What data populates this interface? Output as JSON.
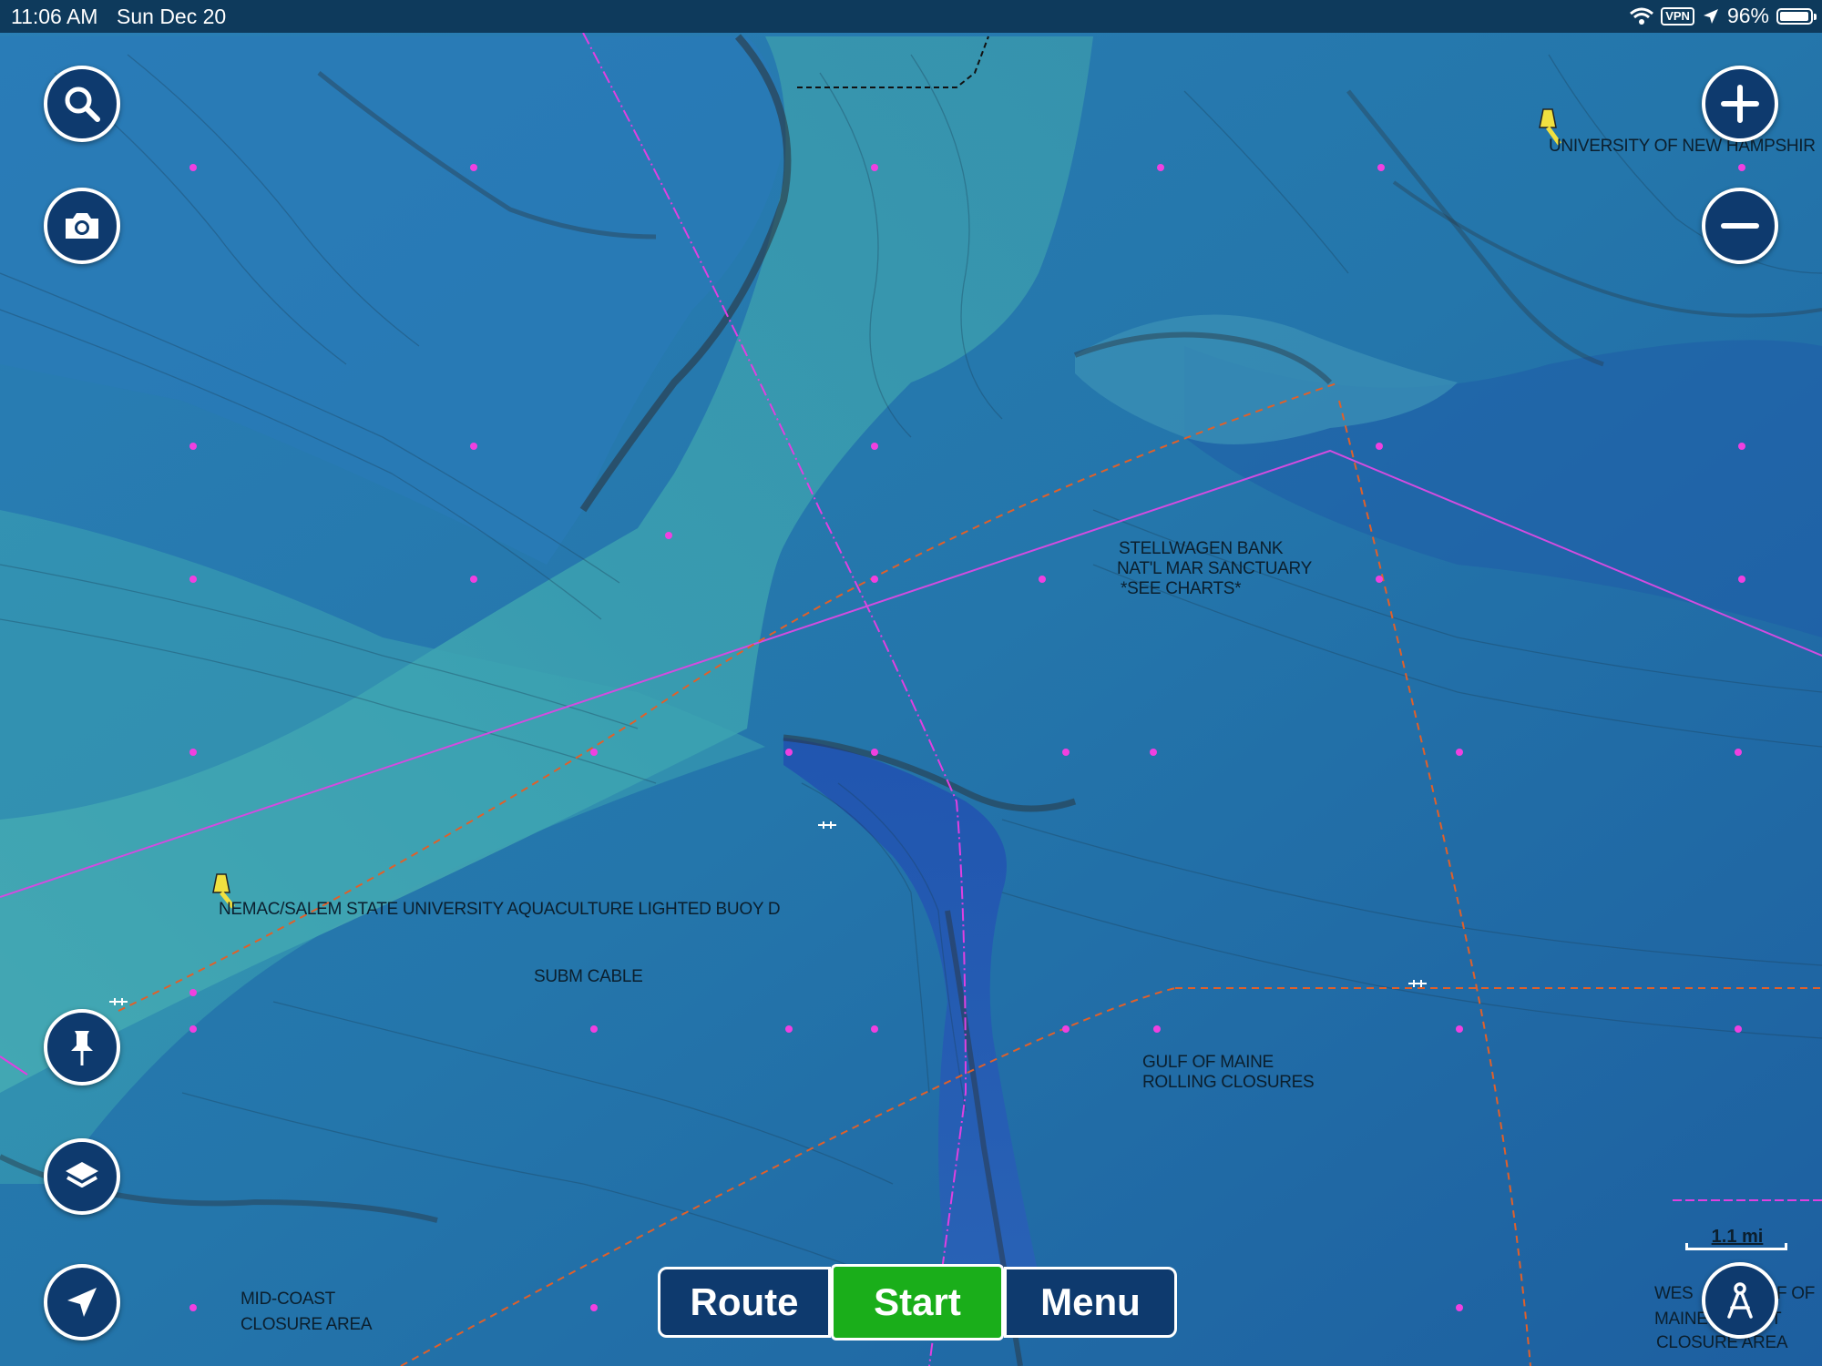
{
  "status_bar": {
    "time": "11:06 AM",
    "date": "Sun Dec 20",
    "vpn_label": "VPN",
    "battery_percent": "96%",
    "battery_level": 0.96
  },
  "map_labels": {
    "unh": "UNIVERSITY OF NEW HAMPSHIR",
    "stellwagen_1": "STELLWAGEN BANK",
    "stellwagen_2": "NAT'L MAR SANCTUARY",
    "stellwagen_3": "*SEE CHARTS*",
    "nemac": "NEMAC/SALEM STATE UNIVERSITY AQUACULTURE LIGHTED BUOY D",
    "subm_cable": "SUBM CABLE",
    "gulf_1": "GULF OF MAINE",
    "gulf_2": "ROLLING CLOSURES",
    "midcoast_1": "MID-COAST",
    "midcoast_2": "CLOSURE AREA",
    "west_1": "WES",
    "west_1b": "F OF",
    "west_2": "MAINE",
    "west_2b": "T",
    "west_3": "CLOSURE AREA"
  },
  "bottom_bar": {
    "route_label": "Route",
    "start_label": "Start",
    "menu_label": "Menu"
  },
  "scale": {
    "label": "1.1 mi"
  },
  "icons": [
    "search-icon",
    "camera-icon",
    "zoom-in-icon",
    "zoom-out-icon",
    "pin-icon",
    "layers-icon",
    "location-arrow-icon",
    "tracking-icon"
  ],
  "colors": {
    "button_bg": "#0e3a6e",
    "start_green": "#1aae1a",
    "status_bar_bg": "#0e3a5c",
    "route_line": "#e040e0",
    "cable_line": "#e06020"
  }
}
